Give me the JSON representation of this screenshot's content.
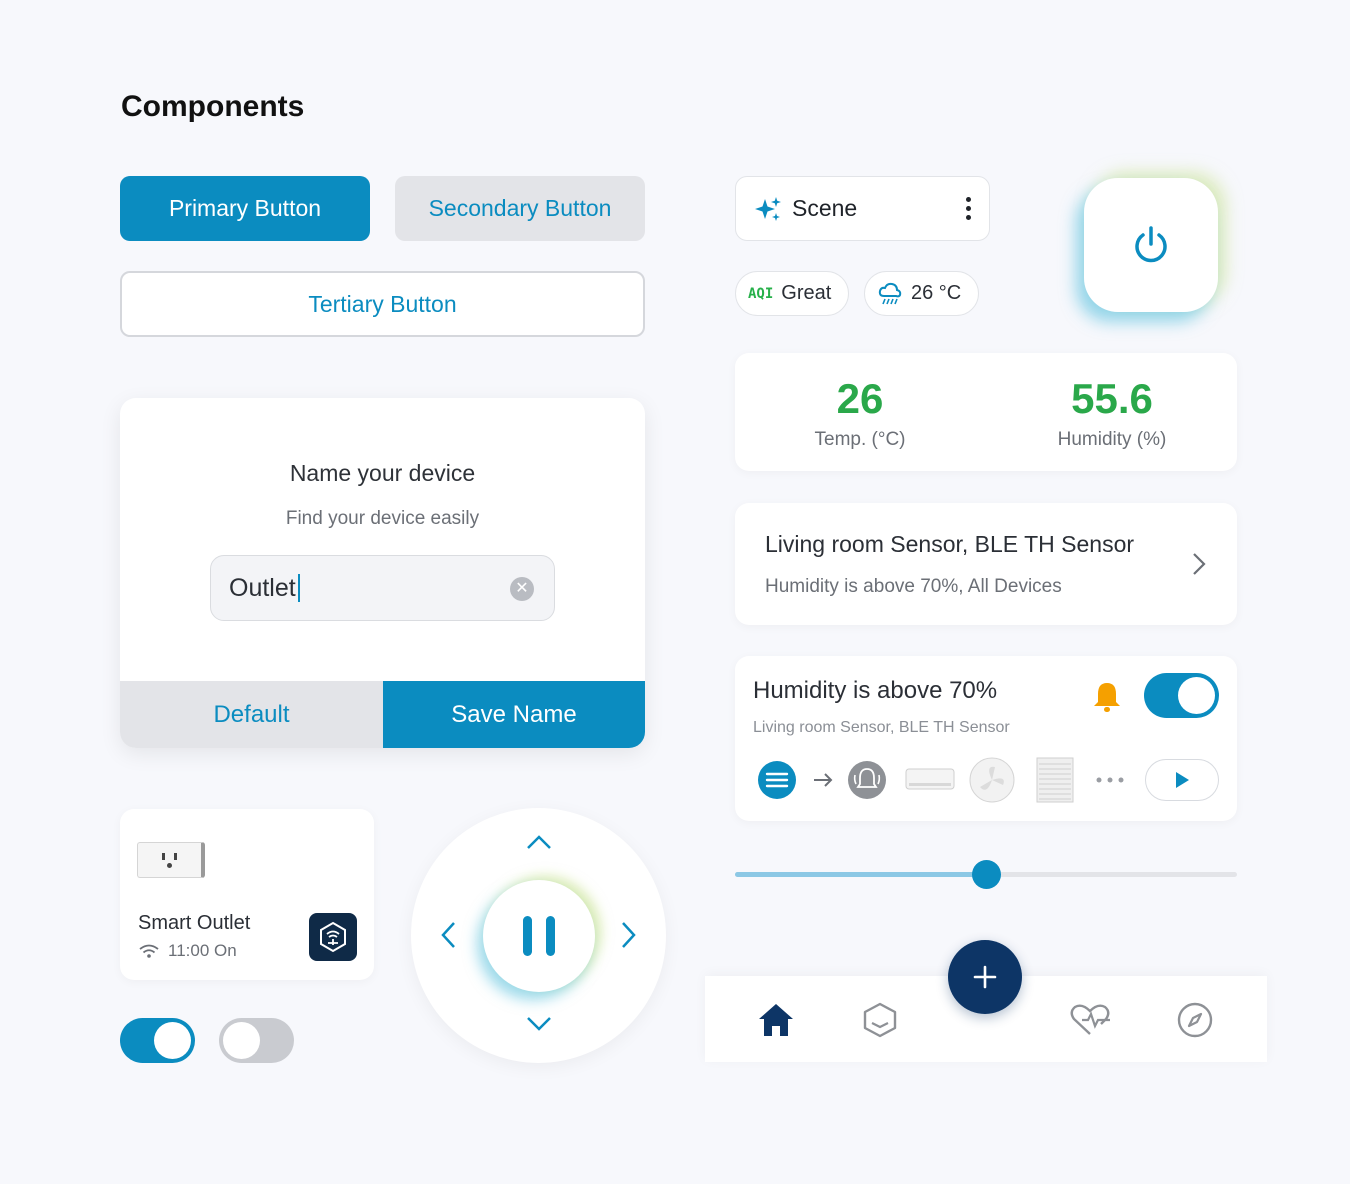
{
  "page": {
    "title": "Components"
  },
  "buttons": {
    "primary": "Primary Button",
    "secondary": "Secondary Button",
    "tertiary": "Tertiary Button"
  },
  "dialog": {
    "title": "Name your device",
    "subtitle": "Find your device easily",
    "input_value": "Outlet",
    "default_label": "Default",
    "save_label": "Save Name"
  },
  "device_card": {
    "name": "Smart Outlet",
    "status": "11:00 On",
    "icon": "wifi-icon"
  },
  "toggles": {
    "first_on": true,
    "second_on": false
  },
  "scene": {
    "label": "Scene",
    "icon": "sparkle-icon"
  },
  "chips": {
    "aqi_tag": "AQI",
    "aqi_value": "Great",
    "temp": "26 °C",
    "weather_icon": "rain-cloud-icon"
  },
  "stats": [
    {
      "value": "26",
      "label": "Temp. (°C)"
    },
    {
      "value": "55.6",
      "label": "Humidity (%)"
    }
  ],
  "sensor_item": {
    "title": "Living room Sensor, BLE TH Sensor",
    "subtitle": "Humidity is above 70%, All Devices"
  },
  "automation": {
    "title": "Humidity is above 70%",
    "subtitle": "Living room Sensor, BLE TH Sensor",
    "enabled": true,
    "actions": [
      "list-icon",
      "arrow-right-icon",
      "alarm-icon",
      "air-conditioner-icon",
      "fan-icon",
      "blinds-icon",
      "more-icon"
    ]
  },
  "slider": {
    "value_percent": 50
  },
  "tabbar": {
    "tabs": [
      "home-icon",
      "hexagon-icon",
      "heart-pulse-icon",
      "compass-icon"
    ],
    "fab_icon": "plus-icon"
  },
  "colors": {
    "primary": "#0b8cc0",
    "success": "#2aa84a",
    "navy": "#0d3566",
    "warning": "#f5a000"
  }
}
